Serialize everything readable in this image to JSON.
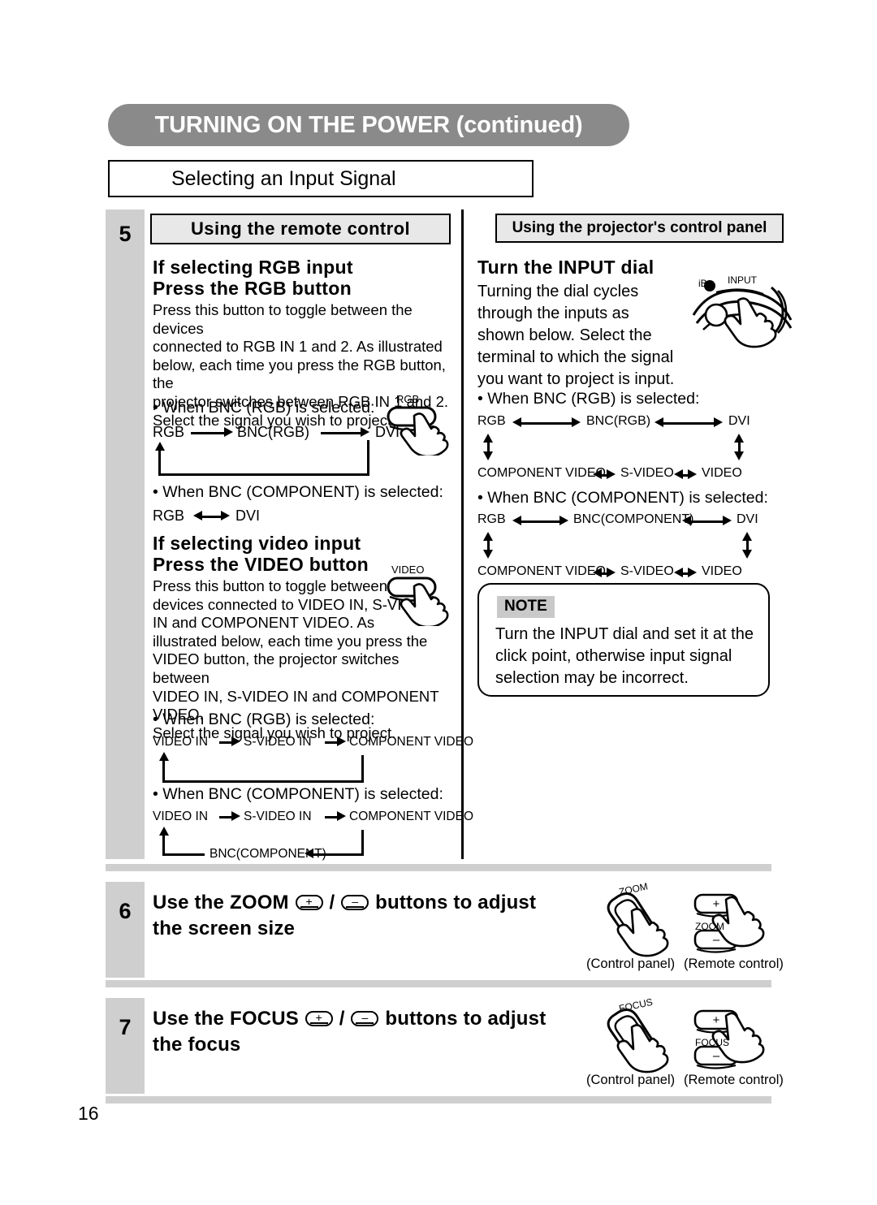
{
  "page": {
    "title": "TURNING ON THE POWER (continued)",
    "subtitle": "Selecting an Input Signal",
    "page_number": "16",
    "accent_banner_color": "#8a8a8a",
    "step_bar_color": "#cfcfcf"
  },
  "step5": {
    "number": "5",
    "left_column": {
      "header": "Using the remote control",
      "rgb_heading": "If selecting RGB input\nPress the RGB button",
      "rgb_body": "Press this button to toggle between the devices\nconnected to RGB IN 1 and 2. As illustrated\nbelow, each time you press the RGB button, the\nprojector switches between RGB IN 1 and 2.\nSelect the signal you wish to project.",
      "rgb_button_label": "RGB",
      "rgb_case1_bullet": "• When BNC (RGB) is selected:",
      "rgb_case1_nodes": [
        "RGB",
        "BNC(RGB)",
        "DVI"
      ],
      "rgb_case2_bullet": "• When BNC (COMPONENT) is selected:",
      "rgb_case2_nodes": [
        "RGB",
        "DVI"
      ],
      "video_heading": "If selecting video input\nPress the VIDEO button",
      "video_body": "Press this button to toggle between the\ndevices connected to VIDEO IN, S-VIDEO\nIN and COMPONENT VIDEO. As\nillustrated below, each time you press the\nVIDEO button, the projector switches between\nVIDEO IN, S-VIDEO IN and COMPONENT VIDEO.\nSelect the signal you wish to project.",
      "video_button_label": "VIDEO",
      "video_case1_bullet": "• When BNC (RGB) is selected:",
      "video_case1_nodes": [
        "VIDEO IN",
        "S-VIDEO IN",
        "COMPONENT VIDEO"
      ],
      "video_case2_bullet": "• When BNC (COMPONENT) is selected:",
      "video_case2_nodes": [
        "VIDEO IN",
        "S-VIDEO IN",
        "COMPONENT VIDEO"
      ],
      "video_case2_return_node": "BNC(COMPONENT)"
    },
    "right_column": {
      "header": "Using the projector's control panel",
      "dial_heading": "Turn the INPUT dial",
      "dial_body": "Turning the dial cycles\nthrough the inputs as\nshown below. Select the\nterminal to which the signal\nyou want to project is input.",
      "dial_label": "INPUT",
      "dial_side_label": "iB",
      "case1_bullet": "• When BNC (RGB) is selected:",
      "case1_top": [
        "RGB",
        "BNC(RGB)",
        "DVI"
      ],
      "case1_bottom": [
        "COMPONENT VIDEO",
        "S-VIDEO",
        "VIDEO"
      ],
      "case2_bullet": "• When BNC (COMPONENT) is selected:",
      "case2_top": [
        "RGB",
        "BNC(COMPONENT)",
        "DVI"
      ],
      "case2_bottom": [
        "COMPONENT VIDEO",
        "S-VIDEO",
        "VIDEO"
      ],
      "note": {
        "badge": "NOTE",
        "text": "Turn the INPUT dial and set it at the\nclick point, otherwise input signal\nselection may be incorrect."
      }
    }
  },
  "step6": {
    "number": "6",
    "heading_part1": "Use the ZOOM",
    "plus_symbol": "+",
    "slash": "/",
    "minus_symbol": "–",
    "heading_part2": "buttons to adjust",
    "heading_line2": "the screen size",
    "control_panel_label": "ZOOM",
    "remote_label": "ZOOM",
    "caption_control": "(Control panel)",
    "caption_remote": "(Remote control)"
  },
  "step7": {
    "number": "7",
    "heading_part1": "Use the FOCUS",
    "plus_symbol": "+",
    "slash": "/",
    "minus_symbol": "–",
    "heading_part2": "buttons to adjust",
    "heading_line2": "the focus",
    "control_panel_label": "FOCUS",
    "remote_label": "FOCUS",
    "caption_control": "(Control panel)",
    "caption_remote": "(Remote control)"
  }
}
